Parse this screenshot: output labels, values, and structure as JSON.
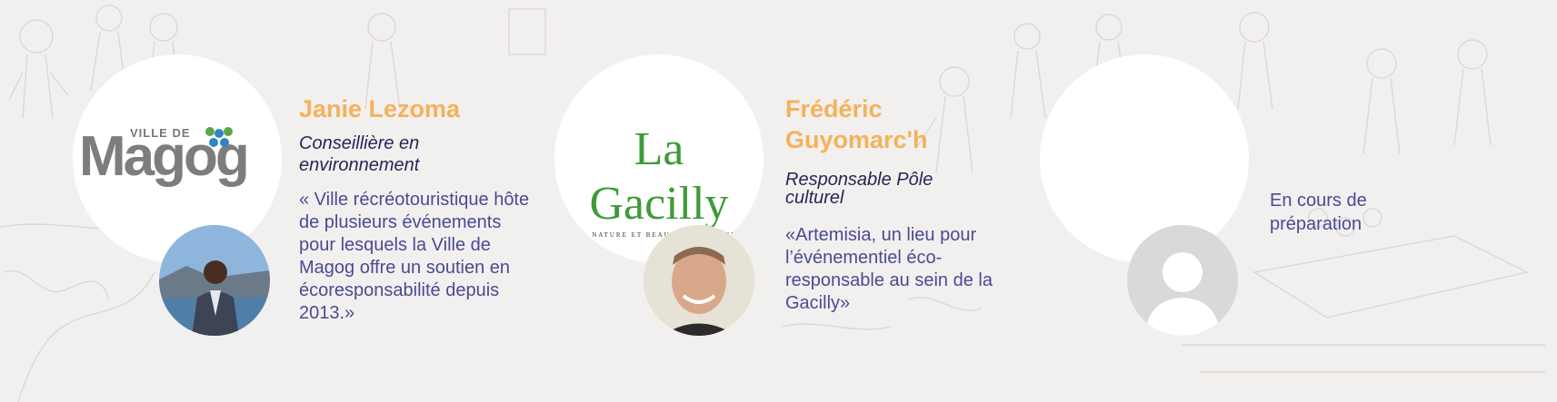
{
  "cards": [
    {
      "name": "Janie Lezoma",
      "role": "Conseillière en environnement",
      "quote": "« Ville récréotouristique hôte de plusieurs événements pour lesquels la Ville de Magog offre un soutien en écoresponsabilité depuis 2013.»",
      "logo": {
        "small": "VILLE DE",
        "big": "Magog"
      },
      "photo_icon": "person-photo"
    },
    {
      "name": "Frédéric Guyomarc'h",
      "role": "Responsable Pôle culturel",
      "quote": "«Artemisia, un lieu pour l’événementiel éco-responsable au sein de la Gacilly»",
      "logo": {
        "big": "La Gacilly",
        "small": "ART, NATURE ET BEAUTÉ EN MORBIHAN"
      },
      "photo_icon": "person-photo"
    },
    {
      "pending": "En cours de préparation",
      "photo_icon": "avatar-placeholder-icon"
    }
  ],
  "colors": {
    "name": "#f5b15b",
    "role": "#2b2355",
    "quote": "#4a4a94",
    "background": "#f2f0ef"
  }
}
